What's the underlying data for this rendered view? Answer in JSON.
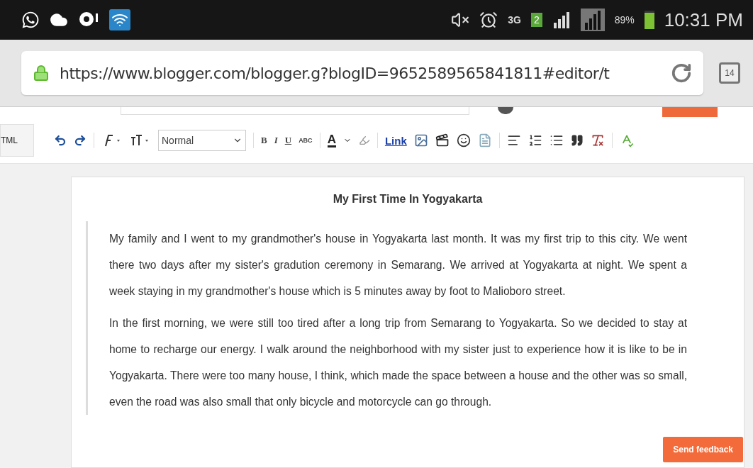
{
  "status_bar": {
    "network": "3G",
    "sim": "2",
    "battery": "89%",
    "time": "10:31 PM"
  },
  "browser": {
    "url": "https://www.blogger.com/blogger.g?blogID=9652589565841811#editor/t",
    "tab_count": "14"
  },
  "toolbar": {
    "html_tab": "TML",
    "style_select": "Normal",
    "bold": "B",
    "italic": "I",
    "underline": "U",
    "strike": "ABC",
    "font_color": "A",
    "link": "Link"
  },
  "post": {
    "title": "My First Time In Yogyakarta",
    "paragraphs": [
      "My family and I went to my grandmother's house in Yogyakarta last month. It was my first trip to this city. We went there two days after my sister's gradution ceremony in Semarang. We arrived at Yogyakarta at night. We spent a week staying in my grandmother's house which is 5 minutes away by foot to Malioboro street.",
      "In the first morning, we were still too tired after a long trip from Semarang to Yogyakarta. So we decided to stay at home to recharge our energy. I walk around the neighborhood with my sister just to experience how it is like to be in Yogyakarta. There were too many house, I think, which made the space between a house and the other was so small, even the road was also small that only bicycle and motorcycle can go through."
    ]
  },
  "feedback_button": "Send feedback"
}
